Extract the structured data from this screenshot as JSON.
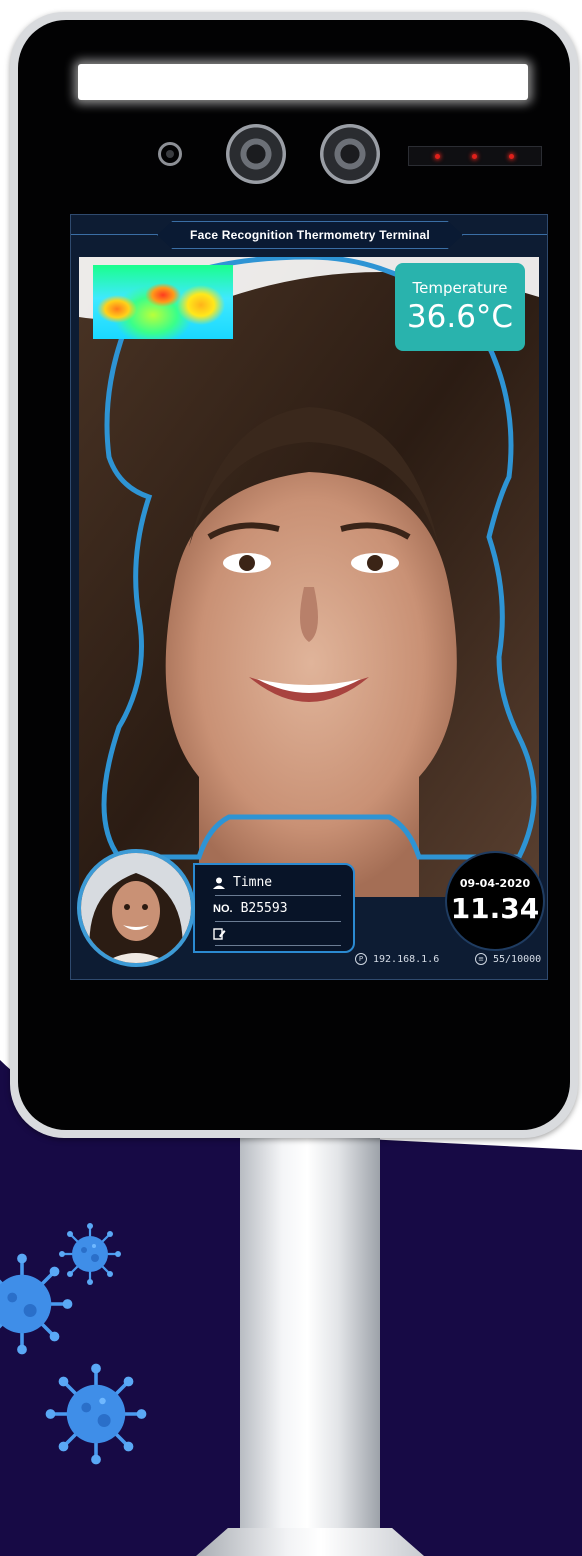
{
  "device": {
    "title": "Face Recognition Thermometry Terminal"
  },
  "temperature": {
    "label": "Temperature",
    "value": "36.6°C"
  },
  "person": {
    "name": "Timne",
    "number_label": "NO.",
    "number": "B25593"
  },
  "clock": {
    "date": "09-04-2020",
    "time": "11.34"
  },
  "status": {
    "ip_address": "192.168.1.6",
    "records": "55/10000"
  },
  "icons": {
    "user": "user-icon",
    "edit": "edit-icon",
    "ip": "ip-icon",
    "records": "database-icon",
    "virus": "virus-icon"
  },
  "colors": {
    "background_navy": "#170a45",
    "screen_bg": "#0d1c33",
    "accent_blue": "#2b8ad1",
    "temperature_box": "#29b3ad",
    "ir_led": "#e0201b"
  }
}
